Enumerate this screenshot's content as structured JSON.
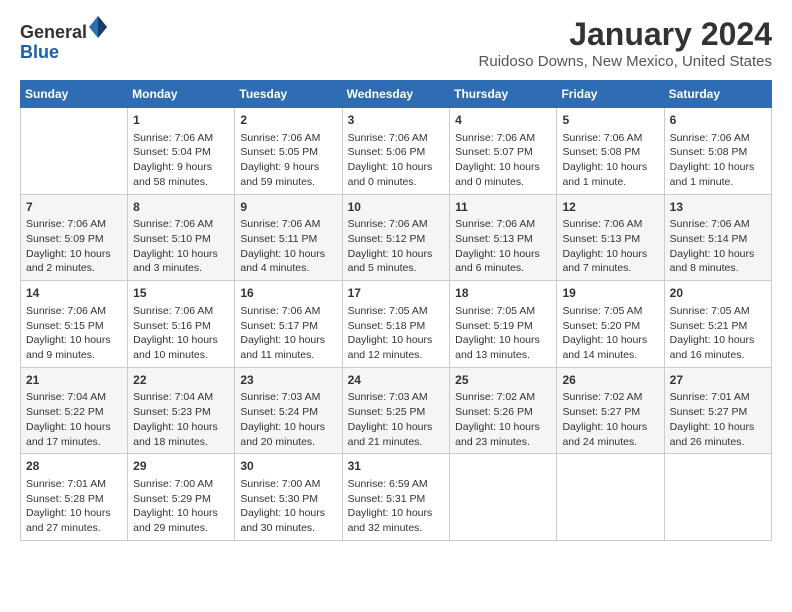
{
  "logo": {
    "text_general": "General",
    "text_blue": "Blue"
  },
  "title": "January 2024",
  "subtitle": "Ruidoso Downs, New Mexico, United States",
  "days_header": [
    "Sunday",
    "Monday",
    "Tuesday",
    "Wednesday",
    "Thursday",
    "Friday",
    "Saturday"
  ],
  "weeks": [
    [
      {
        "num": "",
        "sunrise": "",
        "sunset": "",
        "daylight": ""
      },
      {
        "num": "1",
        "sunrise": "Sunrise: 7:06 AM",
        "sunset": "Sunset: 5:04 PM",
        "daylight": "Daylight: 9 hours and 58 minutes."
      },
      {
        "num": "2",
        "sunrise": "Sunrise: 7:06 AM",
        "sunset": "Sunset: 5:05 PM",
        "daylight": "Daylight: 9 hours and 59 minutes."
      },
      {
        "num": "3",
        "sunrise": "Sunrise: 7:06 AM",
        "sunset": "Sunset: 5:06 PM",
        "daylight": "Daylight: 10 hours and 0 minutes."
      },
      {
        "num": "4",
        "sunrise": "Sunrise: 7:06 AM",
        "sunset": "Sunset: 5:07 PM",
        "daylight": "Daylight: 10 hours and 0 minutes."
      },
      {
        "num": "5",
        "sunrise": "Sunrise: 7:06 AM",
        "sunset": "Sunset: 5:08 PM",
        "daylight": "Daylight: 10 hours and 1 minute."
      },
      {
        "num": "6",
        "sunrise": "Sunrise: 7:06 AM",
        "sunset": "Sunset: 5:08 PM",
        "daylight": "Daylight: 10 hours and 1 minute."
      }
    ],
    [
      {
        "num": "7",
        "sunrise": "Sunrise: 7:06 AM",
        "sunset": "Sunset: 5:09 PM",
        "daylight": "Daylight: 10 hours and 2 minutes."
      },
      {
        "num": "8",
        "sunrise": "Sunrise: 7:06 AM",
        "sunset": "Sunset: 5:10 PM",
        "daylight": "Daylight: 10 hours and 3 minutes."
      },
      {
        "num": "9",
        "sunrise": "Sunrise: 7:06 AM",
        "sunset": "Sunset: 5:11 PM",
        "daylight": "Daylight: 10 hours and 4 minutes."
      },
      {
        "num": "10",
        "sunrise": "Sunrise: 7:06 AM",
        "sunset": "Sunset: 5:12 PM",
        "daylight": "Daylight: 10 hours and 5 minutes."
      },
      {
        "num": "11",
        "sunrise": "Sunrise: 7:06 AM",
        "sunset": "Sunset: 5:13 PM",
        "daylight": "Daylight: 10 hours and 6 minutes."
      },
      {
        "num": "12",
        "sunrise": "Sunrise: 7:06 AM",
        "sunset": "Sunset: 5:13 PM",
        "daylight": "Daylight: 10 hours and 7 minutes."
      },
      {
        "num": "13",
        "sunrise": "Sunrise: 7:06 AM",
        "sunset": "Sunset: 5:14 PM",
        "daylight": "Daylight: 10 hours and 8 minutes."
      }
    ],
    [
      {
        "num": "14",
        "sunrise": "Sunrise: 7:06 AM",
        "sunset": "Sunset: 5:15 PM",
        "daylight": "Daylight: 10 hours and 9 minutes."
      },
      {
        "num": "15",
        "sunrise": "Sunrise: 7:06 AM",
        "sunset": "Sunset: 5:16 PM",
        "daylight": "Daylight: 10 hours and 10 minutes."
      },
      {
        "num": "16",
        "sunrise": "Sunrise: 7:06 AM",
        "sunset": "Sunset: 5:17 PM",
        "daylight": "Daylight: 10 hours and 11 minutes."
      },
      {
        "num": "17",
        "sunrise": "Sunrise: 7:05 AM",
        "sunset": "Sunset: 5:18 PM",
        "daylight": "Daylight: 10 hours and 12 minutes."
      },
      {
        "num": "18",
        "sunrise": "Sunrise: 7:05 AM",
        "sunset": "Sunset: 5:19 PM",
        "daylight": "Daylight: 10 hours and 13 minutes."
      },
      {
        "num": "19",
        "sunrise": "Sunrise: 7:05 AM",
        "sunset": "Sunset: 5:20 PM",
        "daylight": "Daylight: 10 hours and 14 minutes."
      },
      {
        "num": "20",
        "sunrise": "Sunrise: 7:05 AM",
        "sunset": "Sunset: 5:21 PM",
        "daylight": "Daylight: 10 hours and 16 minutes."
      }
    ],
    [
      {
        "num": "21",
        "sunrise": "Sunrise: 7:04 AM",
        "sunset": "Sunset: 5:22 PM",
        "daylight": "Daylight: 10 hours and 17 minutes."
      },
      {
        "num": "22",
        "sunrise": "Sunrise: 7:04 AM",
        "sunset": "Sunset: 5:23 PM",
        "daylight": "Daylight: 10 hours and 18 minutes."
      },
      {
        "num": "23",
        "sunrise": "Sunrise: 7:03 AM",
        "sunset": "Sunset: 5:24 PM",
        "daylight": "Daylight: 10 hours and 20 minutes."
      },
      {
        "num": "24",
        "sunrise": "Sunrise: 7:03 AM",
        "sunset": "Sunset: 5:25 PM",
        "daylight": "Daylight: 10 hours and 21 minutes."
      },
      {
        "num": "25",
        "sunrise": "Sunrise: 7:02 AM",
        "sunset": "Sunset: 5:26 PM",
        "daylight": "Daylight: 10 hours and 23 minutes."
      },
      {
        "num": "26",
        "sunrise": "Sunrise: 7:02 AM",
        "sunset": "Sunset: 5:27 PM",
        "daylight": "Daylight: 10 hours and 24 minutes."
      },
      {
        "num": "27",
        "sunrise": "Sunrise: 7:01 AM",
        "sunset": "Sunset: 5:27 PM",
        "daylight": "Daylight: 10 hours and 26 minutes."
      }
    ],
    [
      {
        "num": "28",
        "sunrise": "Sunrise: 7:01 AM",
        "sunset": "Sunset: 5:28 PM",
        "daylight": "Daylight: 10 hours and 27 minutes."
      },
      {
        "num": "29",
        "sunrise": "Sunrise: 7:00 AM",
        "sunset": "Sunset: 5:29 PM",
        "daylight": "Daylight: 10 hours and 29 minutes."
      },
      {
        "num": "30",
        "sunrise": "Sunrise: 7:00 AM",
        "sunset": "Sunset: 5:30 PM",
        "daylight": "Daylight: 10 hours and 30 minutes."
      },
      {
        "num": "31",
        "sunrise": "Sunrise: 6:59 AM",
        "sunset": "Sunset: 5:31 PM",
        "daylight": "Daylight: 10 hours and 32 minutes."
      },
      {
        "num": "",
        "sunrise": "",
        "sunset": "",
        "daylight": ""
      },
      {
        "num": "",
        "sunrise": "",
        "sunset": "",
        "daylight": ""
      },
      {
        "num": "",
        "sunrise": "",
        "sunset": "",
        "daylight": ""
      }
    ]
  ]
}
